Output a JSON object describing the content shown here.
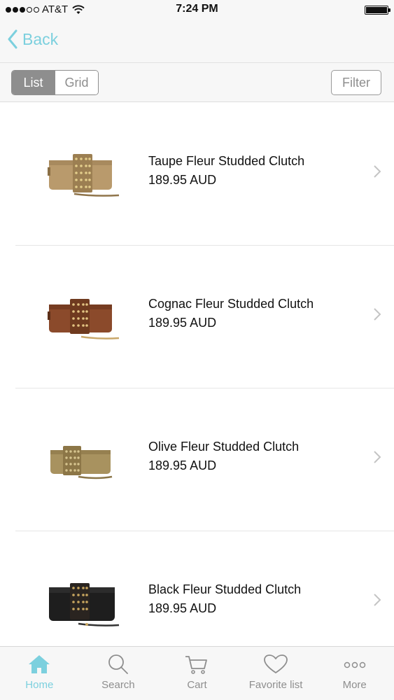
{
  "status_bar": {
    "carrier": "AT&T",
    "time": "7:24 PM",
    "signal_bars_filled": 3,
    "signal_bars_total": 5
  },
  "nav": {
    "back_label": "Back"
  },
  "toolbar": {
    "segments": [
      {
        "label": "List",
        "active": true
      },
      {
        "label": "Grid",
        "active": false
      }
    ],
    "filter_label": "Filter"
  },
  "products": [
    {
      "name": "Taupe Fleur Studded Clutch",
      "price": "189.95 AUD",
      "color": "#b99a6c"
    },
    {
      "name": "Cognac Fleur Studded Clutch",
      "price": "189.95 AUD",
      "color": "#8b4a2b"
    },
    {
      "name": "Olive Fleur Studded Clutch",
      "price": "189.95 AUD",
      "color": "#a8925f"
    },
    {
      "name": "Black Fleur Studded Clutch",
      "price": "189.95 AUD",
      "color": "#1e1e1e"
    }
  ],
  "tabs": [
    {
      "label": "Home",
      "icon": "home-icon",
      "active": true
    },
    {
      "label": "Search",
      "icon": "search-icon",
      "active": false
    },
    {
      "label": "Cart",
      "icon": "cart-icon",
      "active": false
    },
    {
      "label": "Favorite list",
      "icon": "heart-icon",
      "active": false
    },
    {
      "label": "More",
      "icon": "more-icon",
      "active": false
    }
  ],
  "colors": {
    "accent": "#7cd0de",
    "inactive": "#8e8e8e"
  }
}
